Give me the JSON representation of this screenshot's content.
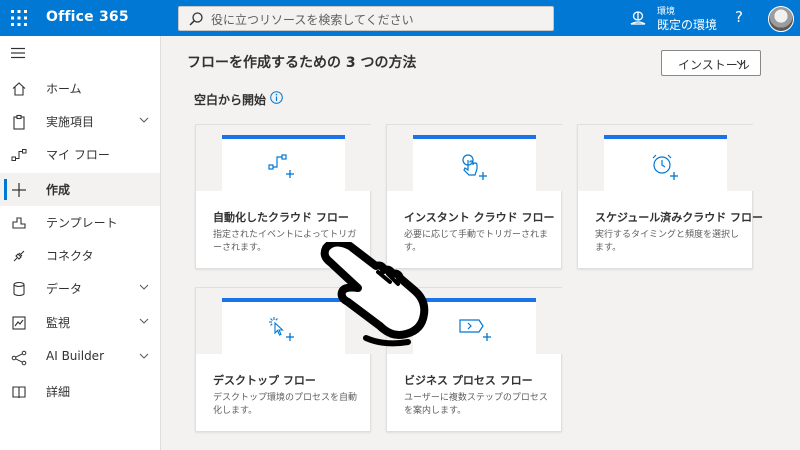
{
  "topbar": {
    "app_name": "Office 365",
    "search_placeholder": "役に立つリソースを検索してください",
    "environment_label": "環境",
    "environment_value": "既定の環境",
    "help_label": "?"
  },
  "sidebar": {
    "items": [
      {
        "label": "ホーム",
        "icon": "home-icon"
      },
      {
        "label": "実施項目",
        "icon": "clipboard-icon",
        "expandable": true
      },
      {
        "label": "マイ フロー",
        "icon": "flow-icon"
      },
      {
        "label": "作成",
        "icon": "plus-icon",
        "active": true
      },
      {
        "label": "テンプレート",
        "icon": "template-icon"
      },
      {
        "label": "コネクタ",
        "icon": "connector-icon"
      },
      {
        "label": "データ",
        "icon": "database-icon",
        "expandable": true
      },
      {
        "label": "監視",
        "icon": "monitor-icon",
        "expandable": true
      },
      {
        "label": "AI Builder",
        "icon": "ai-builder-icon",
        "expandable": true
      },
      {
        "label": "詳細",
        "icon": "book-icon"
      }
    ]
  },
  "main": {
    "title": "フローを作成するための 3 つの方法",
    "install_label": "インストール",
    "section_title": "空白から開始",
    "cards": [
      {
        "title": "自動化したクラウド フロー",
        "desc": "指定されたイベントによってトリガーされます。",
        "icon": "automated-flow-icon"
      },
      {
        "title": "インスタント クラウド フロー",
        "desc": "必要に応じて手動でトリガーされます。",
        "icon": "touch-icon"
      },
      {
        "title": "スケジュール済みクラウド フロー",
        "desc": "実行するタイミングと頻度を選択します。",
        "icon": "alarm-clock-icon"
      },
      {
        "title": "デスクトップ フロー",
        "desc": "デスクトップ環境のプロセスを自動化します。",
        "icon": "desktop-click-icon"
      },
      {
        "title": "ビジネス プロセス フロー",
        "desc": "ユーザーに複数ステップのプロセスを案内します。",
        "icon": "business-process-icon"
      }
    ]
  },
  "colors": {
    "brand_blue": "#0078d4",
    "card_accent": "#1a73e8",
    "page_bg": "#f3f2f1"
  }
}
